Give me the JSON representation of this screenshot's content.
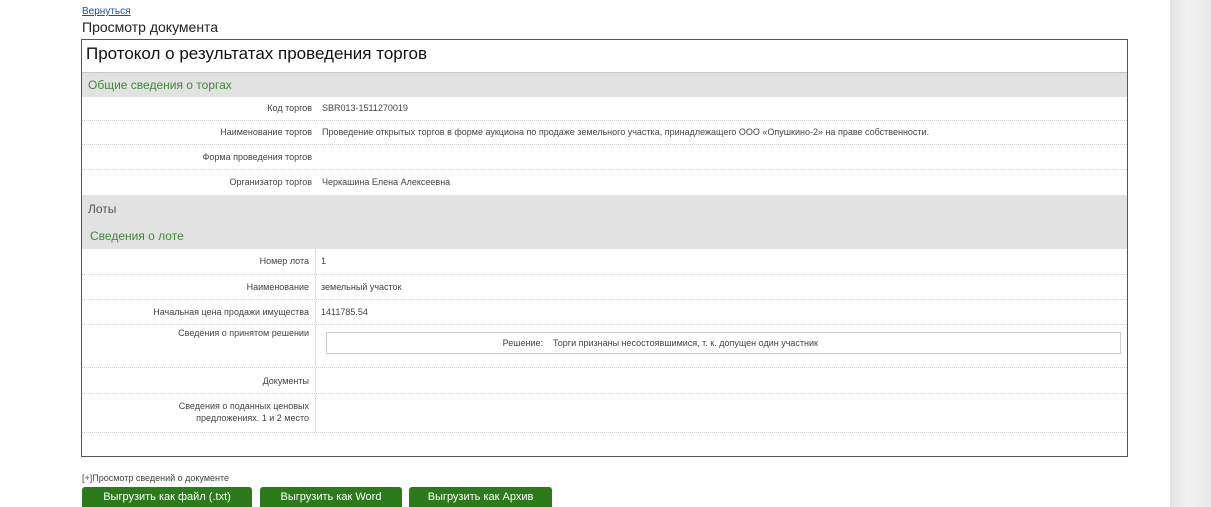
{
  "back_link": "Вернуться",
  "view_title": "Просмотр документа",
  "doc_title": "Протокол о результатах проведения торгов",
  "general": {
    "heading": "Общие сведения о торгах",
    "rows": [
      {
        "label": "Код торгов",
        "value": "SBR013-1511270019"
      },
      {
        "label": "Наименование торгов",
        "value": "Проведение открытых торгов в форме аукциона по продаже земельного участка, принадлежащего ООО «Опушкино-2» на праве собственности."
      },
      {
        "label": "Форма проведения торгов",
        "value": ""
      },
      {
        "label": "Организатор торгов",
        "value": "Черкашина Елена Алексеевна"
      }
    ]
  },
  "lots": {
    "heading": "Лоты",
    "subheading": "Сведения о лоте",
    "rows": [
      {
        "label": "Номер лота",
        "value": "1"
      },
      {
        "label": "Наименование",
        "value": "земельный участок"
      },
      {
        "label": "Начальная цена продажи имущества",
        "value": "1411785.54"
      },
      {
        "label": "Сведения о принятом решении",
        "value": ""
      },
      {
        "label": "Документы",
        "value": ""
      },
      {
        "label": "Сведения о поданных ценовых предложениях. 1 и 2 место",
        "value": ""
      }
    ],
    "decision": {
      "label": "Решение:",
      "value": "Торги признаны несостоявшимися, т. к. допущен один участник"
    }
  },
  "toggle_link": "[+]Просмотр сведений о документе",
  "buttons": {
    "export_txt": "Выгрузить как файл (.txt)",
    "export_word": "Выгрузить как Word",
    "export_archive": "Выгрузить как Архив"
  }
}
